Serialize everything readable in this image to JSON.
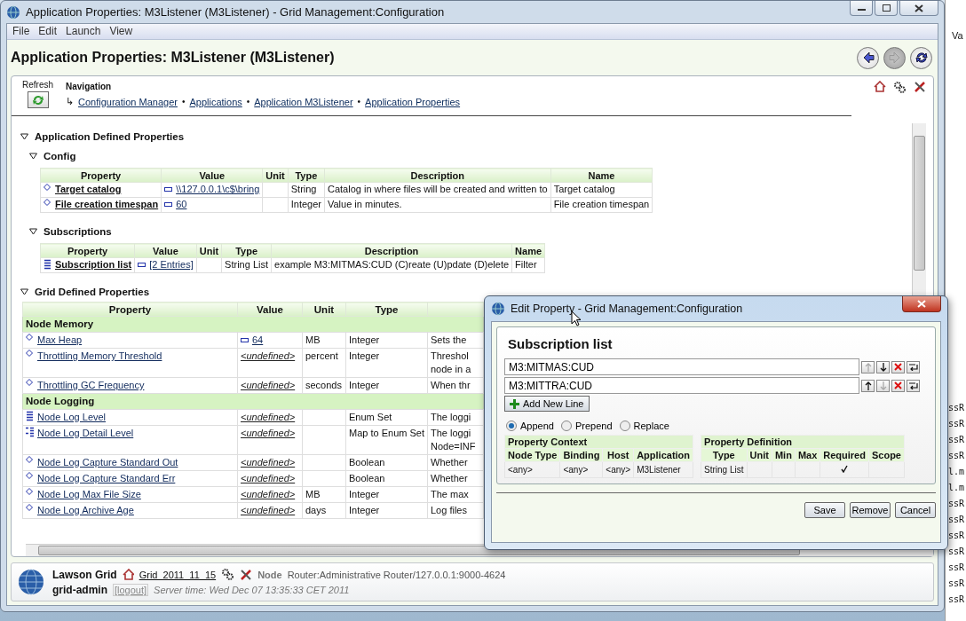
{
  "window": {
    "title": "Application Properties: M3Listener (M3Listener) - Grid Management:Configuration"
  },
  "menu": [
    {
      "label": "File"
    },
    {
      "label": "Edit"
    },
    {
      "label": "Launch"
    },
    {
      "label": "View"
    }
  ],
  "header": {
    "title": "Application Properties: M3Listener (M3Listener)",
    "nav_buttons": [
      {
        "kind": "back",
        "disabled": false
      },
      {
        "kind": "forward",
        "disabled": true
      },
      {
        "kind": "reload",
        "disabled": false
      }
    ]
  },
  "toolbar": {
    "refresh_label": "Refresh",
    "navigation_label": "Navigation",
    "breadcrumb_arrow": "↳",
    "breadcrumbs": [
      {
        "label": "Configuration Manager"
      },
      {
        "label": "Applications",
        "separator": "•"
      },
      {
        "label": "Application M3Listener",
        "separator": "•"
      },
      {
        "label": "Application Properties",
        "separator": "•"
      }
    ]
  },
  "application_properties": {
    "title": "Application Defined Properties",
    "expanded": true,
    "groups": [
      {
        "title": "Config",
        "expanded": true,
        "columns": [
          "Property",
          "Value",
          "Unit",
          "Type",
          "Description",
          "Name"
        ],
        "rows": [
          {
            "kind": "single",
            "property": "Target catalog",
            "value": "\\\\127.0.0.1\\c$\\bring",
            "undefined": false,
            "type": "String",
            "description": "Catalog in where files will be created and written to",
            "name": "Target catalog"
          },
          {
            "kind": "single",
            "property": "File creation timespan",
            "value": "60",
            "undefined": false,
            "type": "Integer",
            "description": "Value in minutes.",
            "name": "File creation timespan"
          }
        ]
      },
      {
        "title": "Subscriptions",
        "expanded": true,
        "columns": [
          "Property",
          "Value",
          "Unit",
          "Type",
          "Description",
          "Name"
        ],
        "rows": [
          {
            "kind": "list",
            "property": "Subscription list",
            "value": "[2 Entries]",
            "undefined": false,
            "type": "String List",
            "description": "example M3:MITMAS:CUD (C)reate (U)pdate (D)elete",
            "name": "Filter"
          }
        ]
      }
    ]
  },
  "grid_properties": {
    "title": "Grid Defined Properties",
    "expanded": true,
    "columns": [
      "Property",
      "Value",
      "Unit",
      "Type"
    ],
    "sections": [
      {
        "title": "Node Memory",
        "rows": [
          {
            "kind": "single",
            "property": "Max Heap",
            "value": "64",
            "undefined": false,
            "unit": "MB",
            "type": "Integer",
            "description": [
              "Sets the"
            ]
          },
          {
            "kind": "single",
            "property": "Throttling Memory Threshold",
            "value": "<undefined>",
            "undefined": true,
            "unit": "percent",
            "type": "Integer",
            "description": [
              "Threshol",
              "node in a"
            ]
          },
          {
            "kind": "single",
            "property": "Throttling GC Frequency",
            "value": "<undefined>",
            "undefined": true,
            "unit": "seconds",
            "type": "Integer",
            "description": [
              "When thr"
            ]
          }
        ]
      },
      {
        "title": "Node Logging",
        "rows": [
          {
            "kind": "list",
            "property": "Node Log Level",
            "value": "<undefined>",
            "undefined": true,
            "type": "Enum Set",
            "description": [
              "The loggi"
            ]
          },
          {
            "kind": "map",
            "property": "Node Log Detail Level",
            "value": "<undefined>",
            "undefined": true,
            "type": "Map to Enum Set",
            "description": [
              "The loggi",
              "Node=INF"
            ]
          },
          {
            "kind": "single",
            "property": "Node Log Capture Standard Out",
            "value": "<undefined>",
            "undefined": true,
            "type": "Boolean",
            "description": [
              "Whether"
            ]
          },
          {
            "kind": "single",
            "property": "Node Log Capture Standard Err",
            "value": "<undefined>",
            "undefined": true,
            "type": "Boolean",
            "description": [
              "Whether"
            ]
          },
          {
            "kind": "single",
            "property": "Node Log Max File Size",
            "value": "<undefined>",
            "undefined": true,
            "unit": "MB",
            "type": "Integer",
            "description": [
              "The max"
            ]
          },
          {
            "kind": "single",
            "property": "Node Log Archive Age",
            "value": "<undefined>",
            "undefined": true,
            "unit": "days",
            "type": "Integer",
            "description": [
              "Log files"
            ]
          }
        ]
      }
    ]
  },
  "footer": {
    "product": "Lawson Grid",
    "user": "grid-admin",
    "logout": "[logout]",
    "grid": "Grid_2011_11_15",
    "node_label": "Node",
    "node": "Router:Administrative Router/127.0.0.1:9000-4624",
    "server_time": "Server time: Wed Dec 07 13:35:33 CET 2011"
  },
  "dialog": {
    "title": "Edit Property - Grid Management:Configuration",
    "heading": "Subscription list",
    "lines": [
      {
        "value": "M3:MITMAS:CUD",
        "up_disabled": true,
        "down_disabled": false
      },
      {
        "value": "M3:MITTRA:CUD",
        "up_disabled": false,
        "down_disabled": true
      }
    ],
    "add_label": "Add New Line",
    "modes": [
      {
        "label": "Append",
        "selected": true
      },
      {
        "label": "Prepend",
        "selected": false
      },
      {
        "label": "Replace",
        "selected": false
      }
    ],
    "context": {
      "title": "Property Context",
      "columns": [
        "Node Type",
        "Binding",
        "Host",
        "Application"
      ],
      "row": [
        "<any>",
        "<any>",
        "<any>",
        "M3Listener"
      ]
    },
    "definition": {
      "title": "Property Definition",
      "columns": [
        "Type",
        "Unit",
        "Min",
        "Max",
        "Required",
        "Scope"
      ],
      "type": "String List",
      "required": true
    },
    "buttons": [
      {
        "label": "Save"
      },
      {
        "label": "Remove"
      },
      {
        "label": "Cancel"
      }
    ]
  },
  "background_window": {
    "header_fragment": "Va",
    "lines": [
      "ssR",
      "ssR",
      "ssR",
      "ssR",
      "l.m",
      "l.m",
      "ssR",
      "ssR",
      "ssR",
      "ssR",
      "ssR",
      "ssR",
      "ssR"
    ]
  }
}
